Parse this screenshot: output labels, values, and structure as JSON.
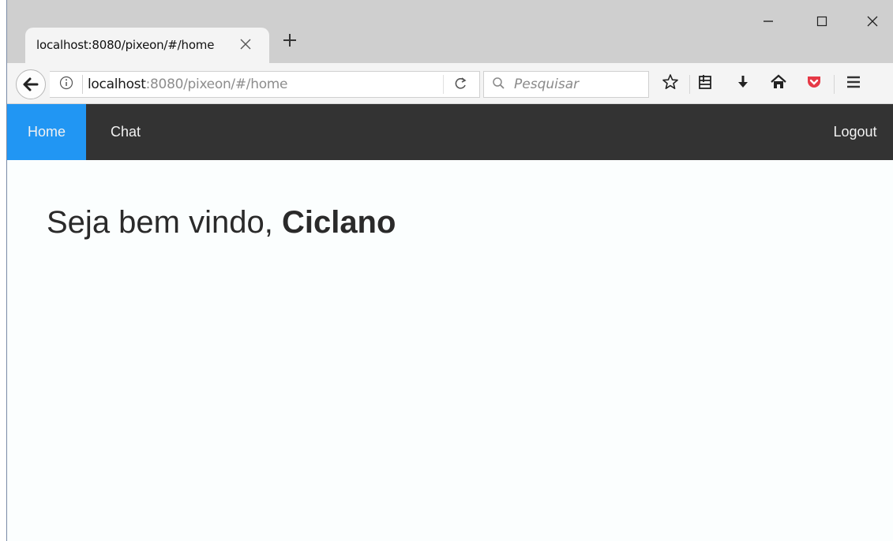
{
  "browser": {
    "tab_title": "localhost:8080/pixeon/#/home",
    "url_host": "localhost",
    "url_rest": ":8080/pixeon/#/home",
    "search_placeholder": "Pesquisar",
    "icons": {
      "back": "back-arrow-icon",
      "info": "info-icon",
      "reload": "reload-icon",
      "search": "search-icon",
      "bookmark": "star-icon",
      "reading_list": "bookmark-list-icon",
      "download": "download-icon",
      "home": "home-icon",
      "pocket": "pocket-icon",
      "menu": "hamburger-menu-icon"
    }
  },
  "nav": {
    "items": [
      {
        "label": "Home",
        "active": true
      },
      {
        "label": "Chat",
        "active": false
      }
    ],
    "logout_label": "Logout",
    "active_color": "#2196f3",
    "bg_color": "#333333"
  },
  "main": {
    "greeting_prefix": "Seja bem vindo, ",
    "user_name": "Ciclano"
  }
}
